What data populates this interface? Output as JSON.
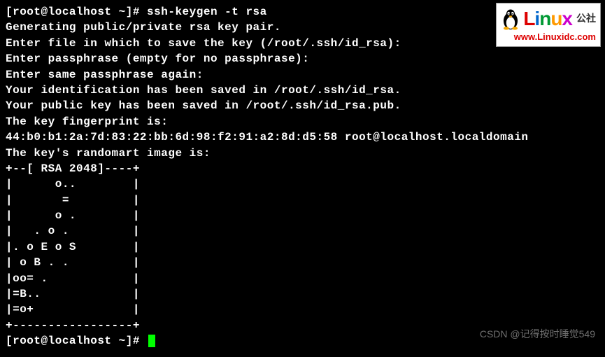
{
  "terminal": {
    "prompt": "[root@localhost ~]# ",
    "command": "ssh-keygen -t rsa",
    "lines": [
      "Generating public/private rsa key pair.",
      "Enter file in which to save the key (/root/.ssh/id_rsa):",
      "Enter passphrase (empty for no passphrase):",
      "Enter same passphrase again:",
      "Your identification has been saved in /root/.ssh/id_rsa.",
      "Your public key has been saved in /root/.ssh/id_rsa.pub.",
      "The key fingerprint is:",
      "44:b0:b1:2a:7d:83:22:bb:6d:98:f2:91:a2:8d:d5:58 root@localhost.localdomain",
      "The key's randomart image is:",
      "+--[ RSA 2048]----+",
      "|      o..        |",
      "|       =         |",
      "|      o .        |",
      "|   . o .         |",
      "|. o E o S        |",
      "| o B . .         |",
      "|oo= .            |",
      "|=B..             |",
      "|=o+              |",
      "+-----------------+"
    ],
    "prompt2": "[root@localhost ~]# "
  },
  "logo": {
    "text_l": "L",
    "text_i": "i",
    "text_n": "n",
    "text_u": "u",
    "text_x": "x",
    "cn": "公社",
    "url": "www.Linuxidc.com"
  },
  "watermark": "CSDN @记得按时睡觉549"
}
